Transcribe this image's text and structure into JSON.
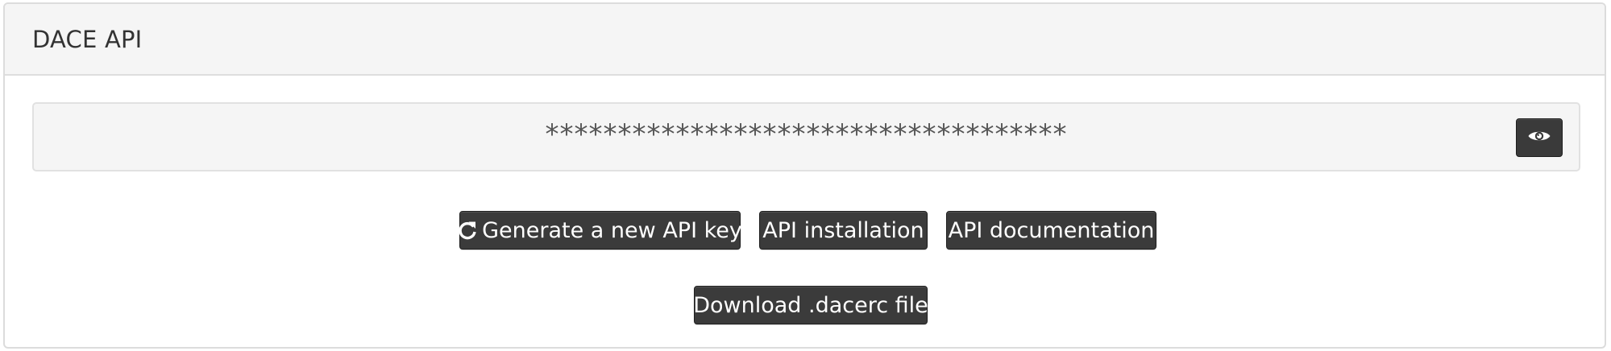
{
  "panel": {
    "title": "DACE API"
  },
  "api_key": {
    "masked_value": "************************************",
    "reveal_icon": "eye-icon"
  },
  "actions": {
    "generate_label": "Generate a new API key",
    "generate_icon": "refresh-icon",
    "installation_label": "API installation",
    "documentation_label": "API documentation",
    "download_label": "Download .dacerc file"
  },
  "colors": {
    "button_bg": "#3b3b3b",
    "heading_bg": "#f5f5f5",
    "key_box_bg": "#f5f5f5"
  }
}
